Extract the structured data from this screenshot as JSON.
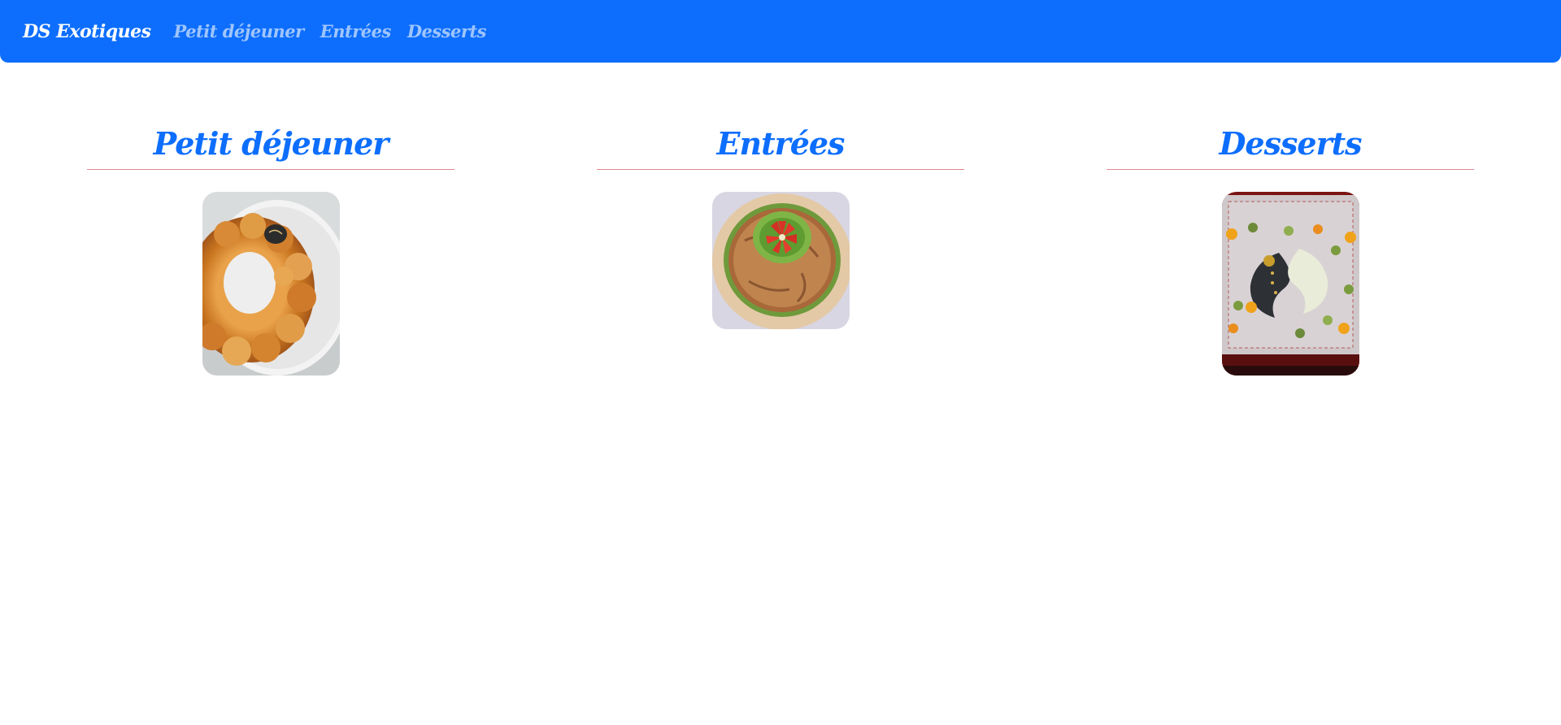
{
  "navbar": {
    "brand": "DS Exotiques",
    "links": [
      "Petit déjeuner",
      "Entrées",
      "Desserts"
    ]
  },
  "sections": [
    {
      "title": "Petit déjeuner",
      "image_alt": "braided brioche ring"
    },
    {
      "title": "Entrées",
      "image_alt": "savory pie crown with tomatoes and lettuce"
    },
    {
      "title": "Desserts",
      "image_alt": "yin yang cake with decorated cups"
    }
  ],
  "colors": {
    "primary": "#0d6efd",
    "nav_link_muted": "rgba(255,255,255,0.6)",
    "divider": "#e3868e"
  }
}
